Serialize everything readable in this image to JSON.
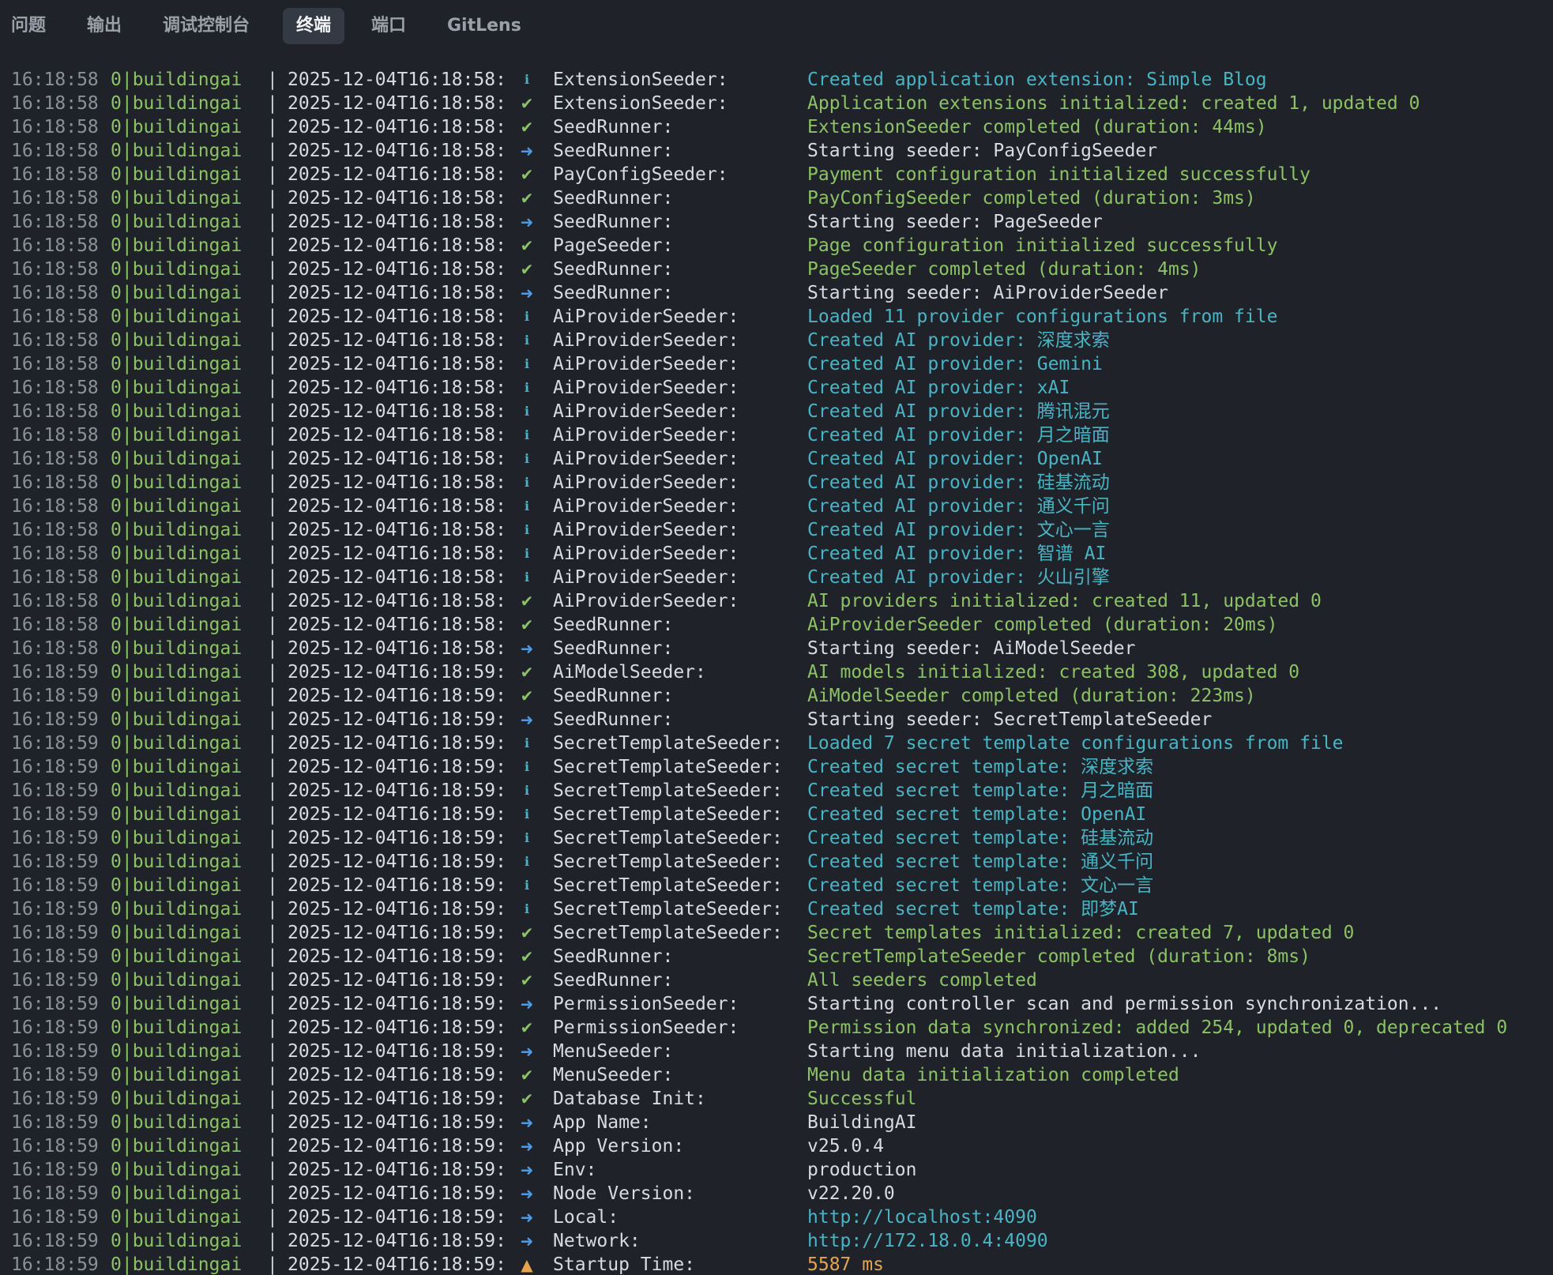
{
  "tabs": [
    {
      "label": "问题",
      "active": false
    },
    {
      "label": "输出",
      "active": false
    },
    {
      "label": "调试控制台",
      "active": false
    },
    {
      "label": "终端",
      "active": true
    },
    {
      "label": "端口",
      "active": false
    },
    {
      "label": "GitLens",
      "active": false
    }
  ],
  "colors": {
    "background": "#1f2329",
    "info": "#4ab3c4",
    "success": "#8cc265",
    "arrow": "#4d9be6",
    "warn": "#e5a54f",
    "default": "#d8dce2",
    "url": "#4ab3c4"
  },
  "icons": {
    "info": {
      "glyph": "ℹ",
      "name": "info-icon"
    },
    "success": {
      "glyph": "✔",
      "name": "check-icon"
    },
    "arrow": {
      "glyph": "➜",
      "name": "arrow-right-icon"
    },
    "warn": {
      "glyph": "▲",
      "name": "warning-icon"
    }
  },
  "separator": "|",
  "lines": [
    {
      "time": "16:18:58",
      "proc": "0|buildingai",
      "ts": "2025-12-04T16:18:58:",
      "level": "info",
      "ctx": "ExtensionSeeder:",
      "msg": "Created application extension: Simple Blog",
      "msgColor": "info"
    },
    {
      "time": "16:18:58",
      "proc": "0|buildingai",
      "ts": "2025-12-04T16:18:58:",
      "level": "success",
      "ctx": "ExtensionSeeder:",
      "msg": "Application extensions initialized: created 1, updated 0",
      "msgColor": "success"
    },
    {
      "time": "16:18:58",
      "proc": "0|buildingai",
      "ts": "2025-12-04T16:18:58:",
      "level": "success",
      "ctx": "SeedRunner:",
      "msg": "ExtensionSeeder completed (duration: 44ms)",
      "msgColor": "success"
    },
    {
      "time": "16:18:58",
      "proc": "0|buildingai",
      "ts": "2025-12-04T16:18:58:",
      "level": "arrow",
      "ctx": "SeedRunner:",
      "msg": "Starting seeder: PayConfigSeeder",
      "msgColor": "default"
    },
    {
      "time": "16:18:58",
      "proc": "0|buildingai",
      "ts": "2025-12-04T16:18:58:",
      "level": "success",
      "ctx": "PayConfigSeeder:",
      "msg": "Payment configuration initialized successfully",
      "msgColor": "success"
    },
    {
      "time": "16:18:58",
      "proc": "0|buildingai",
      "ts": "2025-12-04T16:18:58:",
      "level": "success",
      "ctx": "SeedRunner:",
      "msg": "PayConfigSeeder completed (duration: 3ms)",
      "msgColor": "success"
    },
    {
      "time": "16:18:58",
      "proc": "0|buildingai",
      "ts": "2025-12-04T16:18:58:",
      "level": "arrow",
      "ctx": "SeedRunner:",
      "msg": "Starting seeder: PageSeeder",
      "msgColor": "default"
    },
    {
      "time": "16:18:58",
      "proc": "0|buildingai",
      "ts": "2025-12-04T16:18:58:",
      "level": "success",
      "ctx": "PageSeeder:",
      "msg": "Page configuration initialized successfully",
      "msgColor": "success"
    },
    {
      "time": "16:18:58",
      "proc": "0|buildingai",
      "ts": "2025-12-04T16:18:58:",
      "level": "success",
      "ctx": "SeedRunner:",
      "msg": "PageSeeder completed (duration: 4ms)",
      "msgColor": "success"
    },
    {
      "time": "16:18:58",
      "proc": "0|buildingai",
      "ts": "2025-12-04T16:18:58:",
      "level": "arrow",
      "ctx": "SeedRunner:",
      "msg": "Starting seeder: AiProviderSeeder",
      "msgColor": "default"
    },
    {
      "time": "16:18:58",
      "proc": "0|buildingai",
      "ts": "2025-12-04T16:18:58:",
      "level": "info",
      "ctx": "AiProviderSeeder:",
      "msg": "Loaded 11 provider configurations from file",
      "msgColor": "info"
    },
    {
      "time": "16:18:58",
      "proc": "0|buildingai",
      "ts": "2025-12-04T16:18:58:",
      "level": "info",
      "ctx": "AiProviderSeeder:",
      "msg": "Created AI provider: 深度求索",
      "msgColor": "info"
    },
    {
      "time": "16:18:58",
      "proc": "0|buildingai",
      "ts": "2025-12-04T16:18:58:",
      "level": "info",
      "ctx": "AiProviderSeeder:",
      "msg": "Created AI provider: Gemini",
      "msgColor": "info"
    },
    {
      "time": "16:18:58",
      "proc": "0|buildingai",
      "ts": "2025-12-04T16:18:58:",
      "level": "info",
      "ctx": "AiProviderSeeder:",
      "msg": "Created AI provider: xAI",
      "msgColor": "info"
    },
    {
      "time": "16:18:58",
      "proc": "0|buildingai",
      "ts": "2025-12-04T16:18:58:",
      "level": "info",
      "ctx": "AiProviderSeeder:",
      "msg": "Created AI provider: 腾讯混元",
      "msgColor": "info"
    },
    {
      "time": "16:18:58",
      "proc": "0|buildingai",
      "ts": "2025-12-04T16:18:58:",
      "level": "info",
      "ctx": "AiProviderSeeder:",
      "msg": "Created AI provider: 月之暗面",
      "msgColor": "info"
    },
    {
      "time": "16:18:58",
      "proc": "0|buildingai",
      "ts": "2025-12-04T16:18:58:",
      "level": "info",
      "ctx": "AiProviderSeeder:",
      "msg": "Created AI provider: OpenAI",
      "msgColor": "info"
    },
    {
      "time": "16:18:58",
      "proc": "0|buildingai",
      "ts": "2025-12-04T16:18:58:",
      "level": "info",
      "ctx": "AiProviderSeeder:",
      "msg": "Created AI provider: 硅基流动",
      "msgColor": "info"
    },
    {
      "time": "16:18:58",
      "proc": "0|buildingai",
      "ts": "2025-12-04T16:18:58:",
      "level": "info",
      "ctx": "AiProviderSeeder:",
      "msg": "Created AI provider: 通义千问",
      "msgColor": "info"
    },
    {
      "time": "16:18:58",
      "proc": "0|buildingai",
      "ts": "2025-12-04T16:18:58:",
      "level": "info",
      "ctx": "AiProviderSeeder:",
      "msg": "Created AI provider: 文心一言",
      "msgColor": "info"
    },
    {
      "time": "16:18:58",
      "proc": "0|buildingai",
      "ts": "2025-12-04T16:18:58:",
      "level": "info",
      "ctx": "AiProviderSeeder:",
      "msg": "Created AI provider: 智谱 AI",
      "msgColor": "info"
    },
    {
      "time": "16:18:58",
      "proc": "0|buildingai",
      "ts": "2025-12-04T16:18:58:",
      "level": "info",
      "ctx": "AiProviderSeeder:",
      "msg": "Created AI provider: 火山引擎",
      "msgColor": "info"
    },
    {
      "time": "16:18:58",
      "proc": "0|buildingai",
      "ts": "2025-12-04T16:18:58:",
      "level": "success",
      "ctx": "AiProviderSeeder:",
      "msg": "AI providers initialized: created 11, updated 0",
      "msgColor": "success"
    },
    {
      "time": "16:18:58",
      "proc": "0|buildingai",
      "ts": "2025-12-04T16:18:58:",
      "level": "success",
      "ctx": "SeedRunner:",
      "msg": "AiProviderSeeder completed (duration: 20ms)",
      "msgColor": "success"
    },
    {
      "time": "16:18:58",
      "proc": "0|buildingai",
      "ts": "2025-12-04T16:18:58:",
      "level": "arrow",
      "ctx": "SeedRunner:",
      "msg": "Starting seeder: AiModelSeeder",
      "msgColor": "default"
    },
    {
      "time": "16:18:59",
      "proc": "0|buildingai",
      "ts": "2025-12-04T16:18:59:",
      "level": "success",
      "ctx": "AiModelSeeder:",
      "msg": "AI models initialized: created 308, updated 0",
      "msgColor": "success"
    },
    {
      "time": "16:18:59",
      "proc": "0|buildingai",
      "ts": "2025-12-04T16:18:59:",
      "level": "success",
      "ctx": "SeedRunner:",
      "msg": "AiModelSeeder completed (duration: 223ms)",
      "msgColor": "success"
    },
    {
      "time": "16:18:59",
      "proc": "0|buildingai",
      "ts": "2025-12-04T16:18:59:",
      "level": "arrow",
      "ctx": "SeedRunner:",
      "msg": "Starting seeder: SecretTemplateSeeder",
      "msgColor": "default"
    },
    {
      "time": "16:18:59",
      "proc": "0|buildingai",
      "ts": "2025-12-04T16:18:59:",
      "level": "info",
      "ctx": "SecretTemplateSeeder:",
      "msg": "Loaded 7 secret template configurations from file",
      "msgColor": "info"
    },
    {
      "time": "16:18:59",
      "proc": "0|buildingai",
      "ts": "2025-12-04T16:18:59:",
      "level": "info",
      "ctx": "SecretTemplateSeeder:",
      "msg": "Created secret template: 深度求索",
      "msgColor": "info"
    },
    {
      "time": "16:18:59",
      "proc": "0|buildingai",
      "ts": "2025-12-04T16:18:59:",
      "level": "info",
      "ctx": "SecretTemplateSeeder:",
      "msg": "Created secret template: 月之暗面",
      "msgColor": "info"
    },
    {
      "time": "16:18:59",
      "proc": "0|buildingai",
      "ts": "2025-12-04T16:18:59:",
      "level": "info",
      "ctx": "SecretTemplateSeeder:",
      "msg": "Created secret template: OpenAI",
      "msgColor": "info"
    },
    {
      "time": "16:18:59",
      "proc": "0|buildingai",
      "ts": "2025-12-04T16:18:59:",
      "level": "info",
      "ctx": "SecretTemplateSeeder:",
      "msg": "Created secret template: 硅基流动",
      "msgColor": "info"
    },
    {
      "time": "16:18:59",
      "proc": "0|buildingai",
      "ts": "2025-12-04T16:18:59:",
      "level": "info",
      "ctx": "SecretTemplateSeeder:",
      "msg": "Created secret template: 通义千问",
      "msgColor": "info"
    },
    {
      "time": "16:18:59",
      "proc": "0|buildingai",
      "ts": "2025-12-04T16:18:59:",
      "level": "info",
      "ctx": "SecretTemplateSeeder:",
      "msg": "Created secret template: 文心一言",
      "msgColor": "info"
    },
    {
      "time": "16:18:59",
      "proc": "0|buildingai",
      "ts": "2025-12-04T16:18:59:",
      "level": "info",
      "ctx": "SecretTemplateSeeder:",
      "msg": "Created secret template: 即梦AI",
      "msgColor": "info"
    },
    {
      "time": "16:18:59",
      "proc": "0|buildingai",
      "ts": "2025-12-04T16:18:59:",
      "level": "success",
      "ctx": "SecretTemplateSeeder:",
      "msg": "Secret templates initialized: created 7, updated 0",
      "msgColor": "success"
    },
    {
      "time": "16:18:59",
      "proc": "0|buildingai",
      "ts": "2025-12-04T16:18:59:",
      "level": "success",
      "ctx": "SeedRunner:",
      "msg": "SecretTemplateSeeder completed (duration: 8ms)",
      "msgColor": "success"
    },
    {
      "time": "16:18:59",
      "proc": "0|buildingai",
      "ts": "2025-12-04T16:18:59:",
      "level": "success",
      "ctx": "SeedRunner:",
      "msg": "All seeders completed",
      "msgColor": "success"
    },
    {
      "time": "16:18:59",
      "proc": "0|buildingai",
      "ts": "2025-12-04T16:18:59:",
      "level": "arrow",
      "ctx": "PermissionSeeder:",
      "msg": "Starting controller scan and permission synchronization...",
      "msgColor": "default"
    },
    {
      "time": "16:18:59",
      "proc": "0|buildingai",
      "ts": "2025-12-04T16:18:59:",
      "level": "success",
      "ctx": "PermissionSeeder:",
      "msg": "Permission data synchronized: added 254, updated 0, deprecated 0",
      "msgColor": "success"
    },
    {
      "time": "16:18:59",
      "proc": "0|buildingai",
      "ts": "2025-12-04T16:18:59:",
      "level": "arrow",
      "ctx": "MenuSeeder:",
      "msg": "Starting menu data initialization...",
      "msgColor": "default"
    },
    {
      "time": "16:18:59",
      "proc": "0|buildingai",
      "ts": "2025-12-04T16:18:59:",
      "level": "success",
      "ctx": "MenuSeeder:",
      "msg": "Menu data initialization completed",
      "msgColor": "success"
    },
    {
      "time": "16:18:59",
      "proc": "0|buildingai",
      "ts": "2025-12-04T16:18:59:",
      "level": "success",
      "ctx": "Database Init:",
      "msg": "Successful",
      "msgColor": "success"
    },
    {
      "time": "16:18:59",
      "proc": "0|buildingai",
      "ts": "2025-12-04T16:18:59:",
      "level": "arrow",
      "ctx": "App Name:",
      "msg": "BuildingAI",
      "msgColor": "default"
    },
    {
      "time": "16:18:59",
      "proc": "0|buildingai",
      "ts": "2025-12-04T16:18:59:",
      "level": "arrow",
      "ctx": "App Version:",
      "msg": "v25.0.4",
      "msgColor": "default"
    },
    {
      "time": "16:18:59",
      "proc": "0|buildingai",
      "ts": "2025-12-04T16:18:59:",
      "level": "arrow",
      "ctx": "Env:",
      "msg": "production",
      "msgColor": "default"
    },
    {
      "time": "16:18:59",
      "proc": "0|buildingai",
      "ts": "2025-12-04T16:18:59:",
      "level": "arrow",
      "ctx": "Node Version:",
      "msg": "v22.20.0",
      "msgColor": "default"
    },
    {
      "time": "16:18:59",
      "proc": "0|buildingai",
      "ts": "2025-12-04T16:18:59:",
      "level": "arrow",
      "ctx": "Local:",
      "msg": "http://localhost:4090",
      "msgColor": "url"
    },
    {
      "time": "16:18:59",
      "proc": "0|buildingai",
      "ts": "2025-12-04T16:18:59:",
      "level": "arrow",
      "ctx": "Network:",
      "msg": "http://172.18.0.4:4090",
      "msgColor": "url"
    },
    {
      "time": "16:18:59",
      "proc": "0|buildingai",
      "ts": "2025-12-04T16:18:59:",
      "level": "warn",
      "ctx": "Startup Time:",
      "msg": "5587 ms",
      "msgColor": "warn"
    }
  ]
}
